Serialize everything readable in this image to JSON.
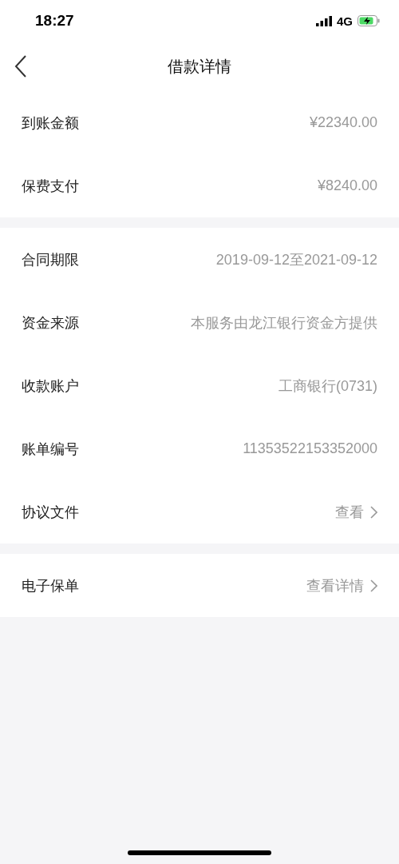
{
  "status_bar": {
    "time": "18:27",
    "network": "4G"
  },
  "nav": {
    "title": "借款详情"
  },
  "sections": [
    {
      "rows": [
        {
          "kind": "text",
          "label": "到账金额",
          "value": "¥22340.00"
        },
        {
          "kind": "text",
          "label": "保费支付",
          "value": "¥8240.00"
        }
      ]
    },
    {
      "rows": [
        {
          "kind": "text",
          "label": "合同期限",
          "value": "2019-09-12至2021-09-12"
        },
        {
          "kind": "text",
          "label": "资金来源",
          "value": "本服务由龙江银行资金方提供"
        },
        {
          "kind": "text",
          "label": "收款账户",
          "value": "工商银行(0731)"
        },
        {
          "kind": "text",
          "label": "账单编号",
          "value": "11353522153352000"
        },
        {
          "kind": "link",
          "label": "协议文件",
          "value": "查看"
        }
      ]
    },
    {
      "rows": [
        {
          "kind": "link",
          "label": "电子保单",
          "value": "查看详情"
        }
      ]
    }
  ]
}
